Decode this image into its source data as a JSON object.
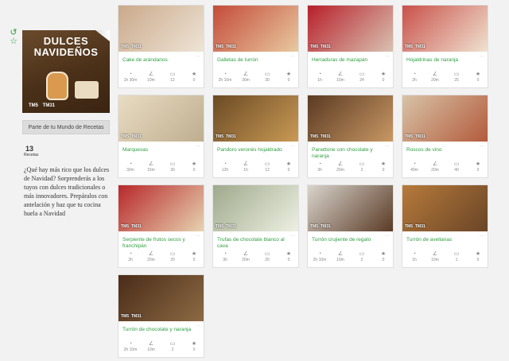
{
  "collection": {
    "title_line1": "DULCES",
    "title_line2": "NAVIDEÑOS",
    "badges": [
      "TM5",
      "TM31"
    ],
    "part_of_label": "Parte de tu Mundo de Recetas",
    "count": "13",
    "count_label": "Recetas",
    "description": "¿Qué hay más rico que los dulces de Navidad? Sorprenderás a los tuyos con dulces tradicionales o más innovadores. Prepáralos con antelación y haz que tu cocina huela a Navidad"
  },
  "sidebar_icons": [
    "back-arrow-icon",
    "star-icon"
  ],
  "card_badges": [
    "TM5",
    "TM31"
  ],
  "meta_icons": [
    "time-icon",
    "difficulty-icon",
    "servings-icon",
    "rating-icon"
  ],
  "recipes": [
    {
      "title": "Cake de arándanos",
      "total": "1h 30m",
      "prep": "10m",
      "servings": "12",
      "rating": "0",
      "colors": [
        "#caa98a",
        "#eee4d6"
      ]
    },
    {
      "title": "Galletas de turrón",
      "total": "2h 10m",
      "prep": "30m",
      "servings": "30",
      "rating": "0",
      "colors": [
        "#c44b3a",
        "#e8c9a0"
      ]
    },
    {
      "title": "Herraduras de mazapán",
      "total": "1h",
      "prep": "10m",
      "servings": "24",
      "rating": "0",
      "colors": [
        "#b71f2a",
        "#d9c2b2"
      ]
    },
    {
      "title": "Hojaldrinas de naranja",
      "total": "2h",
      "prep": "20m",
      "servings": "25",
      "rating": "0",
      "colors": [
        "#c9514a",
        "#f0e2d0"
      ]
    },
    {
      "title": "Marquesas",
      "total": "30m",
      "prep": "15m",
      "servings": "30",
      "rating": "0",
      "colors": [
        "#e9dcc2",
        "#bfae90"
      ]
    },
    {
      "title": "Pandoro veronés hojaldrado",
      "total": "12h",
      "prep": "1h",
      "servings": "12",
      "rating": "0",
      "colors": [
        "#6b4a24",
        "#c99a55"
      ]
    },
    {
      "title": "Panettone con chocolate y naranja",
      "total": "3h",
      "prep": "20m",
      "servings": "2",
      "rating": "0",
      "colors": [
        "#5a3a22",
        "#c89864"
      ]
    },
    {
      "title": "Roscos de vino",
      "total": "40m",
      "prep": "20m",
      "servings": "40",
      "rating": "0",
      "colors": [
        "#d8c3a7",
        "#b35b3c"
      ]
    },
    {
      "title": "Serpiente de frutos secos y franchipán",
      "total": "2h",
      "prep": "20m",
      "servings": "20",
      "rating": "0",
      "colors": [
        "#b8272a",
        "#e6d3b0"
      ]
    },
    {
      "title": "Trufas de chocolate blanco al cava",
      "total": "3h",
      "prep": "20m",
      "servings": "20",
      "rating": "0",
      "colors": [
        "#9fa98c",
        "#eef0e2"
      ]
    },
    {
      "title": "Turrón crujiente de regalo",
      "total": "2h 10m",
      "prep": "10m",
      "servings": "2",
      "rating": "0",
      "colors": [
        "#d9d4cc",
        "#5a3b26"
      ]
    },
    {
      "title": "Turrón de avellanas",
      "total": "1h",
      "prep": "10m",
      "servings": "1",
      "rating": "0",
      "colors": [
        "#b67a3b",
        "#6a4527"
      ]
    },
    {
      "title": "Turrón de chocolate y naranja",
      "total": "2h 10m",
      "prep": "10m",
      "servings": "2",
      "rating": "0",
      "colors": [
        "#4a2c18",
        "#8c6a44"
      ]
    }
  ]
}
